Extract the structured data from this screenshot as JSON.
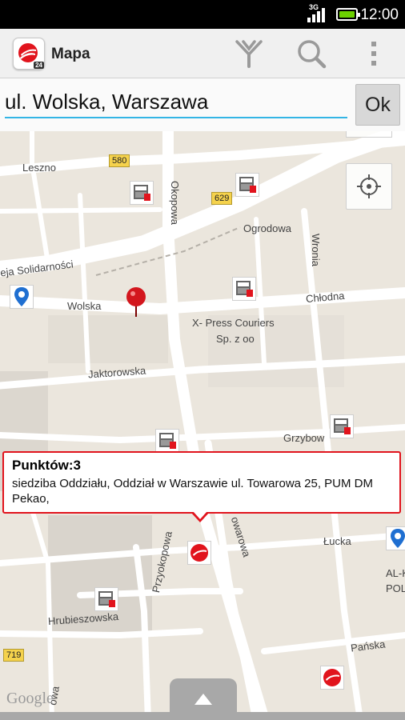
{
  "status_bar": {
    "network": "3G",
    "time": "12:00",
    "battery_color": "#6cd000"
  },
  "action_bar": {
    "title": "Mapa",
    "app_badge": "24",
    "actions": [
      "filter-icon",
      "search-icon",
      "overflow-menu-icon"
    ]
  },
  "search": {
    "value": "ul. Wolska, Warszawa",
    "ok_label": "Ok"
  },
  "map": {
    "streets": [
      "Leszno",
      "Okopowa",
      "Ogrodowa",
      "Wronia",
      "eja Solidarności",
      "Wolska",
      "Chłodna",
      "Jaktorowska",
      "Grzybow",
      "owarowa",
      "Przyokopowa",
      "Łucka",
      "Hrubieszowska",
      "Pańska",
      "owa"
    ],
    "road_shields": [
      "580",
      "629",
      "719"
    ],
    "place_label_1": "X- Press Couriers",
    "place_label_2": "Sp. z oo",
    "partial_label_1": "AL-K",
    "partial_label_2": "POL",
    "attribution": "Google"
  },
  "info_window": {
    "title": "Punktów:3",
    "body": "siedziba Oddziału, Oddział w Warszawie ul. Towarowa 25, PUM DM Pekao,"
  },
  "colors": {
    "accent": "#33b5e5",
    "brand": "#e1141d"
  }
}
